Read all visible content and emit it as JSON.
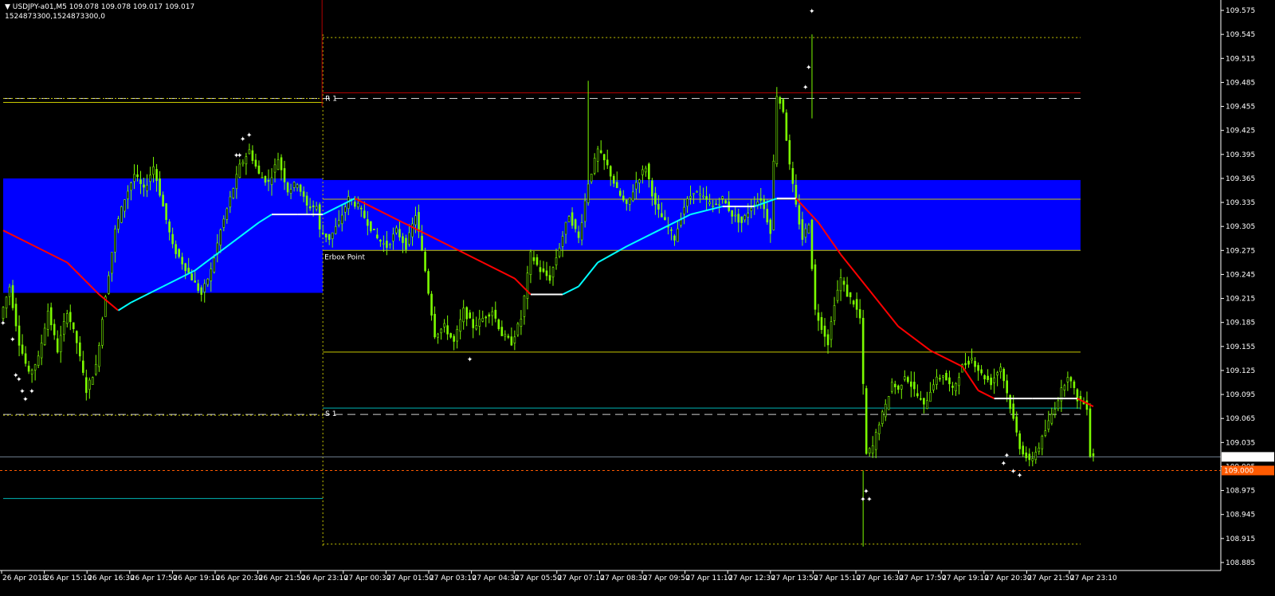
{
  "header": {
    "symbol_line": "USDJPY-a01,M5  109.078 109.078 109.017 109.017",
    "sub_line": "1524873300,1524873300,0"
  },
  "chart_data": {
    "type": "candlestick",
    "symbol": "USDJPY-a01",
    "timeframe": "M5",
    "ohlc_last": {
      "open": 109.078,
      "high": 109.078,
      "low": 109.017,
      "close": 109.017
    },
    "ylim": [
      108.875,
      109.585
    ],
    "price_ticks": [
      "109.575",
      "109.545",
      "109.515",
      "109.485",
      "109.455",
      "109.425",
      "109.395",
      "109.365",
      "109.335",
      "109.305",
      "109.275",
      "109.245",
      "109.215",
      "109.185",
      "109.155",
      "109.125",
      "109.095",
      "109.065",
      "109.035",
      "109.005",
      "108.975",
      "108.945",
      "108.915",
      "108.885"
    ],
    "time_labels": [
      "26 Apr 2018",
      "26 Apr 15:10",
      "26 Apr 16:30",
      "26 Apr 17:50",
      "26 Apr 19:10",
      "26 Apr 20:30",
      "26 Apr 21:50",
      "26 Apr 23:10",
      "27 Apr 00:30",
      "27 Apr 01:50",
      "27 Apr 03:10",
      "27 Apr 04:30",
      "27 Apr 05:50",
      "27 Apr 07:10",
      "27 Apr 08:30",
      "27 Apr 09:50",
      "27 Apr 11:10",
      "27 Apr 12:30",
      "27 Apr 13:50",
      "27 Apr 15:10",
      "27 Apr 16:30",
      "27 Apr 17:50",
      "27 Apr 19:10",
      "27 Apr 20:30",
      "27 Apr 21:50",
      "27 Apr 23:10"
    ],
    "current_price": {
      "label": "109.017",
      "value": 109.017
    },
    "alert_price": {
      "label": "109.000",
      "value": 109.0
    },
    "price_path": [
      [
        0,
        109.19
      ],
      [
        3,
        109.23
      ],
      [
        6,
        109.16
      ],
      [
        9,
        109.12
      ],
      [
        12,
        109.14
      ],
      [
        15,
        109.2
      ],
      [
        18,
        109.15
      ],
      [
        21,
        109.2
      ],
      [
        24,
        109.16
      ],
      [
        27,
        109.1
      ],
      [
        30,
        109.13
      ],
      [
        33,
        109.22
      ],
      [
        36,
        109.3
      ],
      [
        39,
        109.34
      ],
      [
        42,
        109.37
      ],
      [
        45,
        109.35
      ],
      [
        48,
        109.38
      ],
      [
        51,
        109.33
      ],
      [
        54,
        109.28
      ],
      [
        57,
        109.26
      ],
      [
        60,
        109.24
      ],
      [
        63,
        109.22
      ],
      [
        66,
        109.25
      ],
      [
        69,
        109.3
      ],
      [
        72,
        109.34
      ],
      [
        75,
        109.38
      ],
      [
        78,
        109.4
      ],
      [
        81,
        109.37
      ],
      [
        84,
        109.36
      ],
      [
        87,
        109.39
      ],
      [
        90,
        109.35
      ],
      [
        93,
        109.36
      ],
      [
        96,
        109.33
      ],
      [
        99,
        109.33
      ],
      [
        100,
        109.3
      ],
      [
        103,
        109.29
      ],
      [
        106,
        109.31
      ],
      [
        109,
        109.34
      ],
      [
        112,
        109.33
      ],
      [
        115,
        109.31
      ],
      [
        118,
        109.29
      ],
      [
        121,
        109.28
      ],
      [
        124,
        109.3
      ],
      [
        127,
        109.28
      ],
      [
        130,
        109.32
      ],
      [
        133,
        109.25
      ],
      [
        136,
        109.17
      ],
      [
        139,
        109.18
      ],
      [
        142,
        109.16
      ],
      [
        145,
        109.2
      ],
      [
        148,
        109.18
      ],
      [
        151,
        109.19
      ],
      [
        154,
        109.2
      ],
      [
        157,
        109.17
      ],
      [
        160,
        109.16
      ],
      [
        163,
        109.19
      ],
      [
        166,
        109.27
      ],
      [
        169,
        109.25
      ],
      [
        172,
        109.24
      ],
      [
        175,
        109.28
      ],
      [
        178,
        109.32
      ],
      [
        181,
        109.29
      ],
      [
        184,
        109.36
      ],
      [
        187,
        109.4
      ],
      [
        190,
        109.38
      ],
      [
        193,
        109.35
      ],
      [
        196,
        109.33
      ],
      [
        199,
        109.36
      ],
      [
        202,
        109.38
      ],
      [
        205,
        109.33
      ],
      [
        208,
        109.31
      ],
      [
        211,
        109.29
      ],
      [
        214,
        109.33
      ],
      [
        217,
        109.35
      ],
      [
        220,
        109.34
      ],
      [
        223,
        109.33
      ],
      [
        226,
        109.34
      ],
      [
        229,
        109.32
      ],
      [
        232,
        109.31
      ],
      [
        235,
        109.33
      ],
      [
        238,
        109.34
      ],
      [
        241,
        109.3
      ],
      [
        243,
        109.47
      ],
      [
        245,
        109.45
      ],
      [
        247,
        109.38
      ],
      [
        249,
        109.33
      ],
      [
        251,
        109.29
      ],
      [
        253,
        109.31
      ],
      [
        255,
        109.2
      ],
      [
        257,
        109.18
      ],
      [
        259,
        109.16
      ],
      [
        261,
        109.21
      ],
      [
        263,
        109.24
      ],
      [
        265,
        109.22
      ],
      [
        267,
        109.21
      ],
      [
        269,
        109.19
      ],
      [
        271,
        109.02
      ],
      [
        273,
        109.03
      ],
      [
        275,
        109.06
      ],
      [
        277,
        109.08
      ],
      [
        279,
        109.11
      ],
      [
        281,
        109.1
      ],
      [
        283,
        109.12
      ],
      [
        286,
        109.1
      ],
      [
        289,
        109.08
      ],
      [
        292,
        109.11
      ],
      [
        295,
        109.12
      ],
      [
        298,
        109.1
      ],
      [
        301,
        109.13
      ],
      [
        304,
        109.14
      ],
      [
        307,
        109.12
      ],
      [
        310,
        109.11
      ],
      [
        313,
        109.13
      ],
      [
        316,
        109.08
      ],
      [
        319,
        109.03
      ],
      [
        322,
        109.01
      ],
      [
        325,
        109.03
      ],
      [
        328,
        109.06
      ],
      [
        331,
        109.09
      ],
      [
        334,
        109.12
      ],
      [
        337,
        109.09
      ],
      [
        340,
        109.08
      ],
      [
        341,
        109.02
      ]
    ],
    "moving_average": [
      [
        0,
        109.3
      ],
      [
        10,
        109.28
      ],
      [
        20,
        109.26
      ],
      [
        30,
        109.22
      ],
      [
        36,
        109.2
      ],
      [
        40,
        109.21
      ],
      [
        50,
        109.23
      ],
      [
        60,
        109.25
      ],
      [
        70,
        109.28
      ],
      [
        80,
        109.31
      ],
      [
        84,
        109.32
      ],
      [
        92,
        109.32
      ],
      [
        96,
        109.32
      ],
      [
        100,
        109.32
      ],
      [
        105,
        109.33
      ],
      [
        110,
        109.34
      ],
      [
        115,
        109.33
      ],
      [
        120,
        109.32
      ],
      [
        130,
        109.3
      ],
      [
        140,
        109.28
      ],
      [
        150,
        109.26
      ],
      [
        160,
        109.24
      ],
      [
        165,
        109.22
      ],
      [
        175,
        109.22
      ],
      [
        180,
        109.23
      ],
      [
        186,
        109.26
      ],
      [
        195,
        109.28
      ],
      [
        205,
        109.3
      ],
      [
        215,
        109.32
      ],
      [
        225,
        109.33
      ],
      [
        235,
        109.33
      ],
      [
        242,
        109.34
      ],
      [
        248,
        109.34
      ],
      [
        255,
        109.31
      ],
      [
        262,
        109.27
      ],
      [
        270,
        109.23
      ],
      [
        280,
        109.18
      ],
      [
        290,
        109.15
      ],
      [
        300,
        109.13
      ],
      [
        305,
        109.1
      ],
      [
        310,
        109.09
      ],
      [
        316,
        109.09
      ],
      [
        322,
        109.09
      ],
      [
        330,
        109.09
      ],
      [
        336,
        109.09
      ],
      [
        341,
        109.08
      ]
    ],
    "sessions": [
      {
        "from": 0,
        "to": 100,
        "box_high": 109.365,
        "box_low": 109.222,
        "upper_line": 109.46,
        "lower_line": 108.965
      },
      {
        "from": 100,
        "to": 337,
        "box_high": 109.363,
        "box_low": 109.275
      }
    ],
    "levels": [
      {
        "name": "R 1",
        "value": 109.472
      },
      {
        "name": "S 1",
        "value": 109.078
      }
    ],
    "horizontal_lines": [
      {
        "value": 109.541
      },
      {
        "value": 109.465
      },
      {
        "value": 109.339
      },
      {
        "value": 109.275
      },
      {
        "value": 109.148
      },
      {
        "value": 109.07
      },
      {
        "value": 108.908
      }
    ],
    "annotations": [
      {
        "text": "Erbox Point",
        "x": 100,
        "y": 109.27
      }
    ],
    "markers": [
      [
        0,
        109.185
      ],
      [
        3,
        109.165
      ],
      [
        4,
        109.12
      ],
      [
        6,
        109.1
      ],
      [
        7,
        109.09
      ],
      [
        9,
        109.1
      ],
      [
        5,
        109.115
      ],
      [
        73,
        109.395
      ],
      [
        75,
        109.415
      ],
      [
        77,
        109.42
      ],
      [
        74,
        109.395
      ],
      [
        146,
        109.14
      ],
      [
        253,
        109.575
      ],
      [
        252,
        109.505
      ],
      [
        251,
        109.48
      ],
      [
        269,
        108.965
      ],
      [
        271,
        108.965
      ],
      [
        270,
        108.975
      ],
      [
        314,
        109.02
      ],
      [
        316,
        109.0
      ],
      [
        318,
        108.995
      ],
      [
        313,
        109.01
      ]
    ]
  },
  "colors": {
    "candle": "#7CFC00",
    "box": "#0000FF",
    "ma_down": "#FF0000",
    "ma_up": "#00FFFF",
    "level_gold": "#C8C800",
    "level_red": "#B00000",
    "level_cyan": "#00B4B4",
    "current_price_bg": "#FFFFFF",
    "alert_price_bg": "#FF5A00",
    "text": "#FFFFFF"
  }
}
